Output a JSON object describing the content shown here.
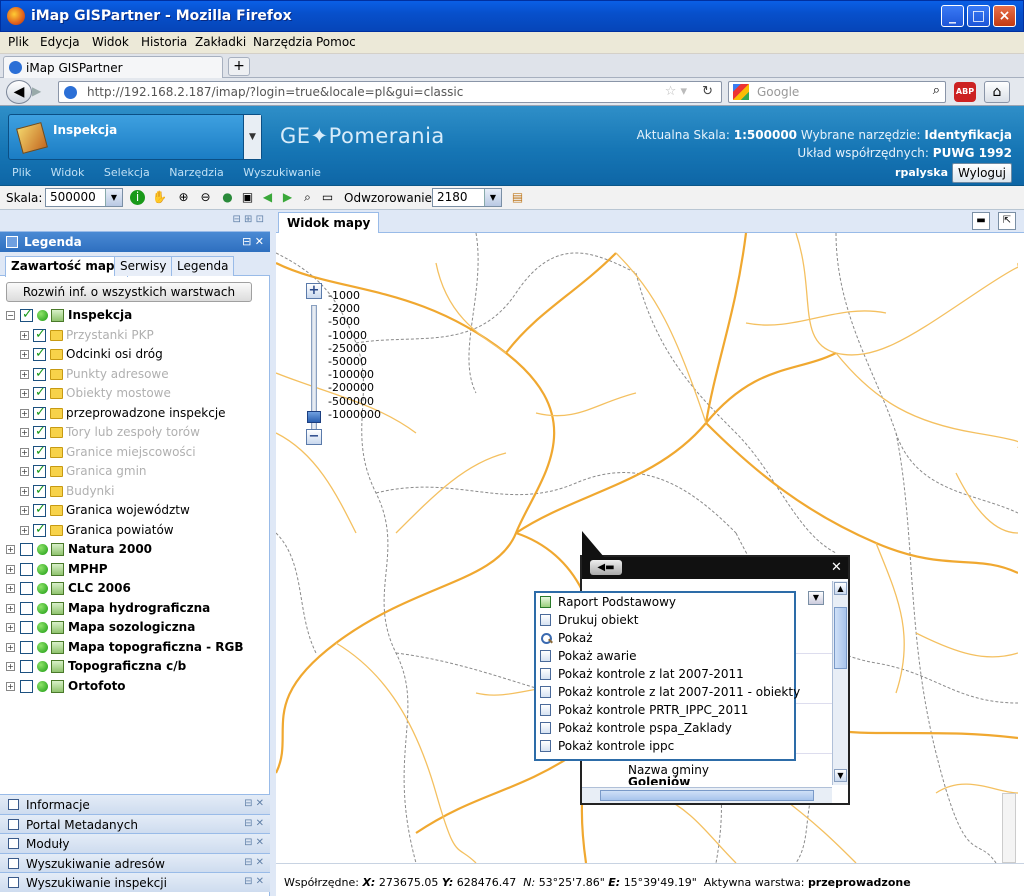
{
  "window": {
    "title": "iMap GISPartner - Mozilla Firefox"
  },
  "menubar": {
    "items": [
      "Plik",
      "Edycja",
      "Widok",
      "Historia",
      "Zakładki",
      "Narzędzia",
      "Pomoc"
    ]
  },
  "browser": {
    "tab_title": "iMap GISPartner",
    "new_tab": "+",
    "url": "http://192.168.2.187/imap/?login=true&locale=pl&gui=classic",
    "search_placeholder": "Google"
  },
  "app": {
    "module": "Inspekcja",
    "logo": "GE✦Pomerania",
    "scale_label": "Aktualna Skala:",
    "scale_value": "1:500000",
    "tool_label": "Wybrane narzędzie:",
    "tool_value": "Identyfikacja",
    "crs_label": "Układ współrzędnych:",
    "crs_value": "PUWG 1992",
    "menu": [
      "Plik",
      "Widok",
      "Selekcja",
      "Narzędzia",
      "Wyszukiwanie"
    ],
    "user": "rpalyska",
    "logout": "Wyloguj"
  },
  "toolbar": {
    "scale_label": "Skala:",
    "scale_value": "500000",
    "proj_label": "Odwzorowanie:",
    "proj_value": "2180"
  },
  "legend": {
    "title": "Legenda",
    "tabs": [
      "Zawartość mapy",
      "Serwisy",
      "Legenda"
    ],
    "expand_button": "Rozwiń inf. o wszystkich warstwach",
    "root": "Inspekcja",
    "children": [
      {
        "label": "Przystanki PKP",
        "checked": true,
        "grey": true
      },
      {
        "label": "Odcinki osi dróg",
        "checked": true,
        "grey": false
      },
      {
        "label": "Punkty adresowe",
        "checked": true,
        "grey": true
      },
      {
        "label": "Obiekty mostowe",
        "checked": true,
        "grey": true
      },
      {
        "label": "przeprowadzone inspekcje",
        "checked": true,
        "grey": false
      },
      {
        "label": "Tory lub zespoły torów",
        "checked": true,
        "grey": true
      },
      {
        "label": "Granice miejscowości",
        "checked": true,
        "grey": true
      },
      {
        "label": "Granica gmin",
        "checked": true,
        "grey": true
      },
      {
        "label": "Budynki",
        "checked": true,
        "grey": true
      },
      {
        "label": "Granica województw",
        "checked": true,
        "grey": false
      },
      {
        "label": "Granica powiatów",
        "checked": true,
        "grey": false
      }
    ],
    "groups": [
      {
        "label": "Natura 2000"
      },
      {
        "label": "MPHP"
      },
      {
        "label": "CLC 2006"
      },
      {
        "label": "Mapa hydrograficzna"
      },
      {
        "label": "Mapa sozologiczna"
      },
      {
        "label": "Mapa topograficzna - RGB"
      },
      {
        "label": "Topograficzna c/b"
      },
      {
        "label": "Ortofoto"
      }
    ]
  },
  "bottom_panels": [
    "Informacje",
    "Portal Metadanych",
    "Moduły",
    "Wyszukiwanie adresów",
    "Wyszukiwanie inspekcji"
  ],
  "map": {
    "tab": "Widok mapy",
    "zoom_in": "+",
    "zoom_out": "−",
    "scales": [
      "1000",
      "2000",
      "5000",
      "10000",
      "25000",
      "50000",
      "100000",
      "200000",
      "500000",
      "1000000"
    ],
    "coords_label": "Współrzędne:",
    "x_label": "X:",
    "x_value": "273675.05",
    "y_label": "Y:",
    "y_value": "628476.47",
    "n_label": "N:",
    "n_value": "53°25'7.86\"",
    "e_label": "E:",
    "e_value": "15°39'49.19\"",
    "active_label": "Aktywna warstwa:",
    "active_value": "przeprowadzone"
  },
  "popup": {
    "field_label": "Nazwa gminy",
    "field_value": "Goleniów"
  },
  "context_menu": [
    {
      "label": "Raport Podstawowy",
      "icon": "report-icon"
    },
    {
      "label": "Drukuj obiekt",
      "icon": "document-icon"
    },
    {
      "label": "Pokaż",
      "icon": "magnifier-icon"
    },
    {
      "label": "Pokaż awarie",
      "icon": "document-icon"
    },
    {
      "label": "Pokaż kontrole z lat 2007-2011",
      "icon": "document-icon"
    },
    {
      "label": "Pokaż kontrole z lat 2007-2011 - obiekty",
      "icon": "document-icon"
    },
    {
      "label": "Pokaż kontrole PRTR_IPPC_2011",
      "icon": "document-icon"
    },
    {
      "label": "Pokaż kontrole pspa_Zaklady",
      "icon": "document-icon"
    },
    {
      "label": "Pokaż kontrole ippc",
      "icon": "document-icon"
    }
  ],
  "colors": {
    "road": "#f0a830",
    "boundary": "#8a8a8a",
    "header": "#1676b5"
  }
}
